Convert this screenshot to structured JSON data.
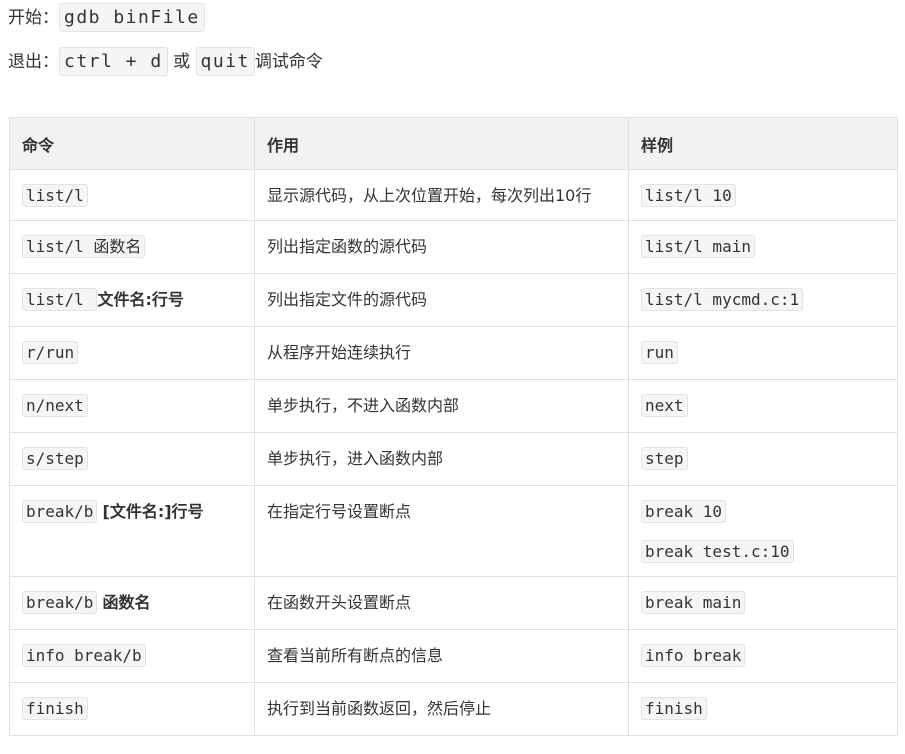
{
  "intro": {
    "start_label": "开始：",
    "start_cmd": "gdb binFile",
    "quit_label": "退出：",
    "quit_cmd1": "ctrl + d",
    "quit_or": "或",
    "quit_cmd2": "quit",
    "quit_suffix": "调试命令"
  },
  "table": {
    "headers": [
      "命令",
      "作用",
      "样例"
    ],
    "rows": [
      {
        "cmd": "list/l",
        "arg": "",
        "desc": "显示源代码，从上次位置开始，每次列出10行",
        "examples": [
          "list/l 10"
        ]
      },
      {
        "cmd": "list/l 函数名",
        "arg": "",
        "desc": "列出指定函数的源代码",
        "examples": [
          "list/l main"
        ]
      },
      {
        "cmd": "list/l ",
        "arg": "文件名:行号",
        "desc": "列出指定文件的源代码",
        "examples": [
          "list/l mycmd.c:1"
        ]
      },
      {
        "cmd": "r/run",
        "arg": "",
        "desc": "从程序开始连续执行",
        "examples": [
          "run"
        ]
      },
      {
        "cmd": "n/next",
        "arg": "",
        "desc": "单步执行，不进入函数内部",
        "examples": [
          "next"
        ]
      },
      {
        "cmd": "s/step",
        "arg": "",
        "desc": "单步执行，进入函数内部",
        "examples": [
          "step"
        ]
      },
      {
        "cmd": "break/b",
        "arg": "[文件名:]行号",
        "desc": "在指定行号设置断点",
        "examples": [
          "break 10",
          "break test.c:10"
        ]
      },
      {
        "cmd": "break/b",
        "arg": "函数名",
        "desc": "在函数开头设置断点",
        "examples": [
          "break main"
        ]
      },
      {
        "cmd": "info break/b",
        "arg": "",
        "desc": "查看当前所有断点的信息",
        "examples": [
          "info break"
        ]
      },
      {
        "cmd": "finish",
        "arg": "",
        "desc": "执行到当前函数返回，然后停止",
        "examples": [
          "finish"
        ]
      }
    ]
  }
}
